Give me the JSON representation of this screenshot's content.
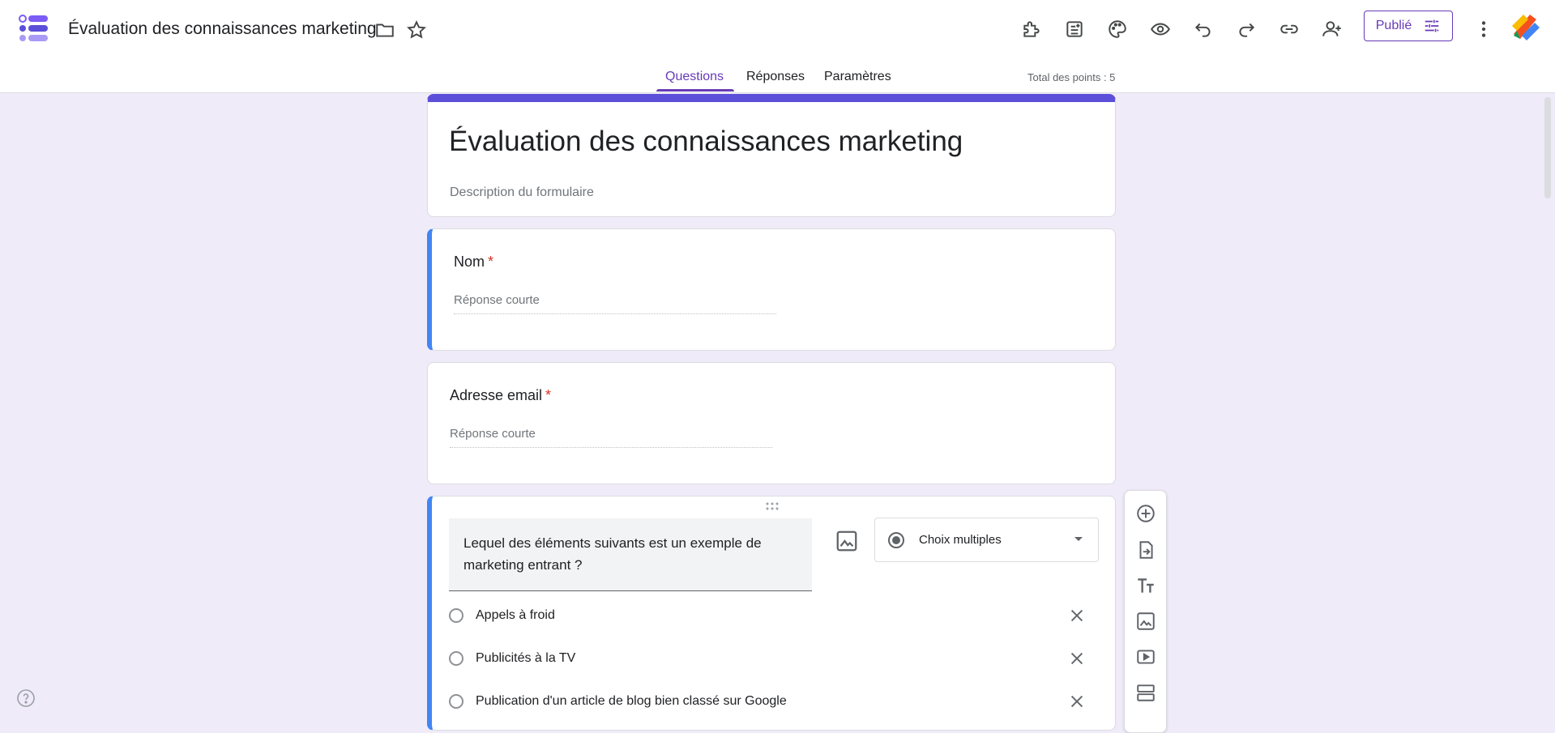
{
  "header": {
    "title": "Évaluation des connaissances marketing",
    "publish_label": "Publié",
    "tabs": [
      {
        "label": "Questions",
        "active": true
      },
      {
        "label": "Réponses",
        "active": false
      },
      {
        "label": "Paramètres",
        "active": false
      }
    ],
    "total_points": "Total des points : 5",
    "icons": [
      "addons-icon",
      "import-questions-icon",
      "theme-palette-icon",
      "preview-eye-icon",
      "undo-icon",
      "redo-icon",
      "link-icon",
      "add-collaborator-icon",
      "more-vert-icon"
    ]
  },
  "form": {
    "title": "Évaluation des connaissances marketing",
    "description_placeholder": "Description du formulaire"
  },
  "questions": [
    {
      "label": "Nom",
      "required_mark": "*",
      "answer_placeholder": "Réponse courte"
    },
    {
      "label": "Adresse email",
      "required_mark": "*",
      "answer_placeholder": "Réponse courte"
    }
  ],
  "active_question": {
    "text": "Lequel des éléments suivants est un exemple de marketing entrant ?",
    "type": "Choix multiples",
    "options": [
      "Appels à froid",
      "Publicités à la TV",
      "Publication d'un article de blog bien classé sur Google"
    ]
  },
  "colors": {
    "accent": "#673ab7",
    "header_bar": "#5b4fd9",
    "active_border": "#4285f4",
    "required": "#d93025",
    "background": "#f0ebf8"
  }
}
